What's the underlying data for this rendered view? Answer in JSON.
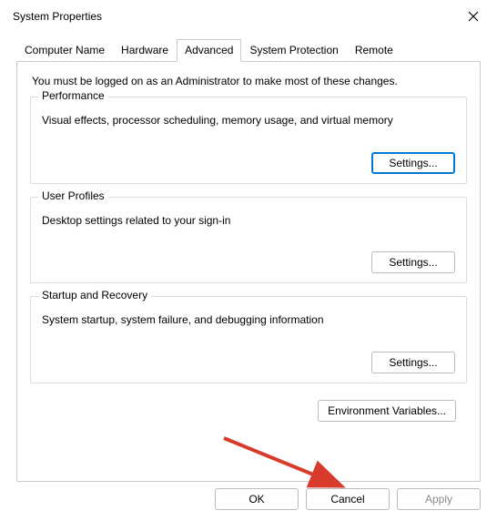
{
  "window": {
    "title": "System Properties"
  },
  "tabs": {
    "computer_name": "Computer Name",
    "hardware": "Hardware",
    "advanced": "Advanced",
    "system_protection": "System Protection",
    "remote": "Remote"
  },
  "admin_note": "You must be logged on as an Administrator to make most of these changes.",
  "performance": {
    "legend": "Performance",
    "desc": "Visual effects, processor scheduling, memory usage, and virtual memory",
    "settings": "Settings..."
  },
  "user_profiles": {
    "legend": "User Profiles",
    "desc": "Desktop settings related to your sign-in",
    "settings": "Settings..."
  },
  "startup": {
    "legend": "Startup and Recovery",
    "desc": "System startup, system failure, and debugging information",
    "settings": "Settings..."
  },
  "env_button": "Environment Variables...",
  "buttons": {
    "ok": "OK",
    "cancel": "Cancel",
    "apply": "Apply"
  }
}
